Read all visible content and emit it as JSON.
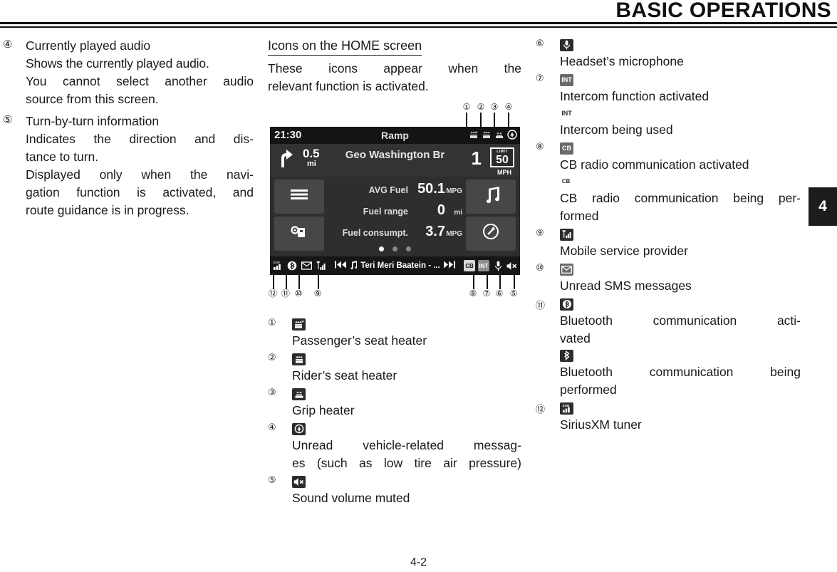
{
  "header": {
    "title": "BASIC OPERATIONS"
  },
  "chapter_tab": {
    "number": "4"
  },
  "page_number": "4-2",
  "left_column": {
    "entries": [
      {
        "num": "④",
        "lines": [
          "Currently played audio",
          "Shows the currently played audio.",
          "You cannot select another audio",
          "source from this screen."
        ]
      },
      {
        "num": "⑤",
        "lines": [
          "Turn-by-turn information",
          "Indicates the direction and dis-",
          "tance to turn.",
          "Displayed only when the navi-",
          "gation function is activated, and",
          "route guidance is in progress."
        ]
      }
    ]
  },
  "mid_column": {
    "heading": "Icons on the HOME screen",
    "intro_line1": "These icons appear when the",
    "intro_line2": "relevant function is activated.",
    "figure": {
      "callouts_top": [
        "①",
        "②",
        "③",
        "④"
      ],
      "callouts_bottom": [
        "⑫",
        "⑪",
        "⑩",
        "⑨",
        "⑧",
        "⑦",
        "⑥",
        "⑤"
      ],
      "dashboard": {
        "time": "21:30",
        "maneuver_title": "Ramp",
        "top_icons": [
          "passenger-seat-heater",
          "rider-seat-heater",
          "grip-heater",
          "vehicle-message"
        ],
        "nav_distance": "0.5",
        "nav_distance_unit": "mi",
        "nav_street": "Geo Washington Br",
        "nav_lane": "1",
        "speed_limit_word": "LIMIT",
        "speed_limit_value": "50",
        "speed_limit_unit": "MPH",
        "stats": [
          {
            "label": "AVG Fuel",
            "value": "50.1",
            "unit": "MPG"
          },
          {
            "label": "Fuel range",
            "value": "0",
            "unit": "mi"
          },
          {
            "label": "Fuel consumpt.",
            "value": "3.7",
            "unit": "MPG"
          }
        ],
        "page_dots": 3,
        "page_dot_active": 1,
        "status_left": [
          "SXM",
          "bluetooth",
          "sms",
          "signal"
        ],
        "track_title": "Teri Meri Baatein - ...",
        "status_right": [
          "CB",
          "INT",
          "mic",
          "mute"
        ]
      }
    },
    "icon_entries": [
      {
        "num": "①",
        "icon": "passenger-seat-heater-icon",
        "glyph": "♨",
        "sub": "P",
        "text": "Passenger’s seat heater"
      },
      {
        "num": "②",
        "icon": "rider-seat-heater-icon",
        "glyph": "♨",
        "sub": "",
        "text": "Rider’s seat heater"
      },
      {
        "num": "③",
        "icon": "grip-heater-icon",
        "glyph": "♨",
        "sub": "",
        "text": "Grip heater"
      },
      {
        "num": "④",
        "icon": "vehicle-message-icon",
        "glyph": "ⓘ",
        "sub": "",
        "text": "Unread vehicle-related messag-\nes (such as low tire air pressure)"
      },
      {
        "num": "⑤",
        "icon": "sound-muted-icon",
        "glyph": "🔇",
        "sub": "",
        "text": "Sound volume muted"
      }
    ]
  },
  "right_column": {
    "icon_entries": [
      {
        "num": "⑥",
        "icon": "microphone-icon",
        "glyph": "🎤",
        "text": "Headset’s microphone",
        "second_icon": null,
        "second_text": null
      },
      {
        "num": "⑦",
        "icon": "intercom-icon",
        "glyph": "INT",
        "text": "Intercom function activated",
        "second_icon": "intercom-active-icon",
        "second_glyph": "INT",
        "second_text": "Intercom being used"
      },
      {
        "num": "⑧",
        "icon": "cb-radio-icon",
        "glyph": "CB",
        "text": "CB radio communication activated",
        "second_icon": "cb-radio-active-icon",
        "second_glyph": "CB",
        "second_text": "CB radio communication being per-\nformed"
      },
      {
        "num": "⑨",
        "icon": "mobile-signal-icon",
        "glyph": "█",
        "text": "Mobile service provider",
        "second_icon": null,
        "second_text": null
      },
      {
        "num": "⑩",
        "icon": "sms-icon",
        "glyph": "✉",
        "text": "Unread SMS messages",
        "second_icon": null,
        "second_text": null
      },
      {
        "num": "⑪",
        "icon": "bluetooth-icon",
        "glyph": "ᛗ",
        "text": "Bluetooth communication acti-\nvated",
        "second_icon": "bluetooth-active-icon",
        "second_glyph": "ᛗ",
        "second_text": "Bluetooth communication being\nperformed"
      },
      {
        "num": "⑫",
        "icon": "siriusxm-icon",
        "glyph": "SXM",
        "text": "SiriusXM tuner",
        "second_icon": null,
        "second_text": null
      }
    ]
  }
}
